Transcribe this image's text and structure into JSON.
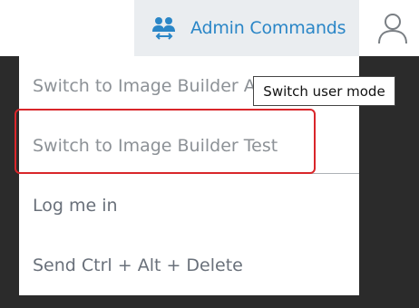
{
  "header": {
    "admin_commands_label": "Admin Commands",
    "admin_icon": "users-switch-icon",
    "user_icon": "user-icon"
  },
  "menu": {
    "items": [
      {
        "label": "Switch to Image Builder Admin",
        "state": "disabled"
      },
      {
        "label": "Switch to Image Builder Test",
        "state": "disabled"
      },
      {
        "label": "Log me in",
        "state": "enabled"
      },
      {
        "label": "Send Ctrl + Alt + Delete",
        "state": "enabled"
      }
    ]
  },
  "tooltip": {
    "text": "Switch user mode"
  },
  "colors": {
    "accent": "#2a86c7",
    "highlight_border": "#d9262a",
    "button_bg": "#eaedf0"
  }
}
